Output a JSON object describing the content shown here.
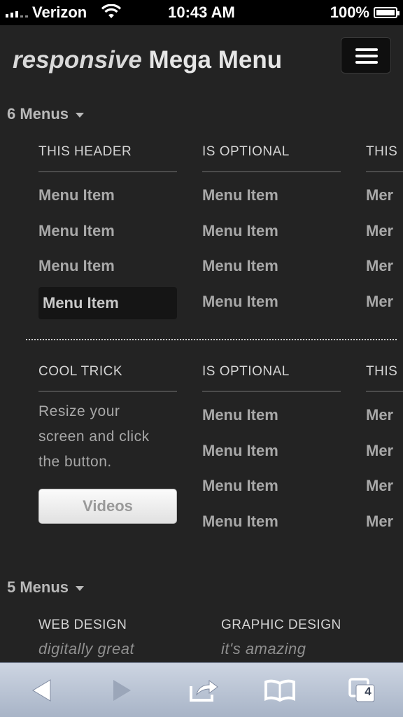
{
  "status_bar": {
    "carrier": "Verizon",
    "time": "10:43 AM",
    "battery": "100%"
  },
  "header": {
    "logo_italic": "responsive",
    "logo_bold": "Mega Menu",
    "menu_icon": "hamburger-icon"
  },
  "group1": {
    "title": "6 Menus",
    "row1": {
      "col1": {
        "header": "THIS HEADER",
        "items": [
          "Menu Item",
          "Menu Item",
          "Menu Item",
          "Menu Item"
        ]
      },
      "col2": {
        "header": "IS OPTIONAL",
        "items": [
          "Menu Item",
          "Menu Item",
          "Menu Item",
          "Menu Item"
        ]
      },
      "col3": {
        "header": "THIS",
        "items": [
          "Mer",
          "Mer",
          "Mer",
          "Mer"
        ]
      }
    },
    "row2": {
      "col1": {
        "header": "COOL TRICK",
        "text_lines": [
          "Resize your",
          "screen and click",
          "the button."
        ],
        "button": "Videos"
      },
      "col2": {
        "header": "IS OPTIONAL",
        "items": [
          "Menu Item",
          "Menu Item",
          "Menu Item",
          "Menu Item"
        ]
      },
      "col3": {
        "header": "THIS",
        "items": [
          "Mer",
          "Mer",
          "Mer",
          "Mer"
        ]
      }
    }
  },
  "group2": {
    "title": "5 Menus",
    "col1": {
      "header": "WEB DESIGN",
      "tagline": "digitally great"
    },
    "col2": {
      "header": "GRAPHIC DESIGN",
      "tagline": "it's amazing"
    }
  },
  "toolbar": {
    "tabs_count": "4",
    "icons": [
      "back-icon",
      "forward-icon",
      "share-icon",
      "bookmarks-icon",
      "tabs-icon"
    ]
  }
}
